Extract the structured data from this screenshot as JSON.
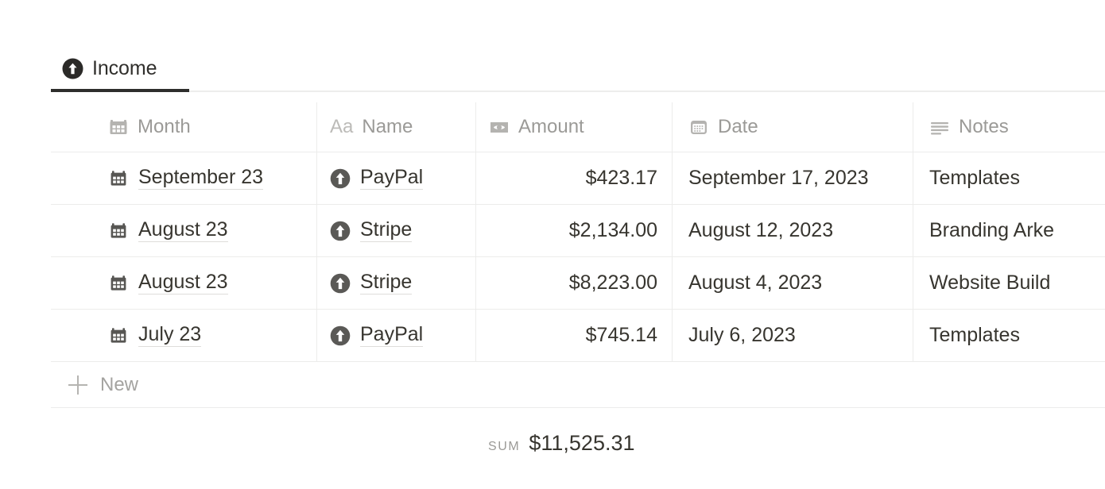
{
  "tab": {
    "label": "Income",
    "icon": "up-arrow-circle-icon",
    "active": true,
    "underline_color": "#2e2e2c"
  },
  "table": {
    "columns": [
      {
        "key": "month",
        "label": "Month",
        "icon": "calendar-icon",
        "align": "left"
      },
      {
        "key": "name",
        "label": "Name",
        "icon": "aa-text-icon",
        "align": "left"
      },
      {
        "key": "amount",
        "label": "Amount",
        "icon": "banknote-icon",
        "align": "right"
      },
      {
        "key": "date",
        "label": "Date",
        "icon": "date-icon",
        "align": "left"
      },
      {
        "key": "notes",
        "label": "Notes",
        "icon": "text-lines-icon",
        "align": "left"
      }
    ],
    "rows": [
      {
        "month": "September 23",
        "month_icon": "calendar-icon",
        "name": "PayPal",
        "name_icon": "up-arrow-circle-icon",
        "amount": "$423.17",
        "date": "September 17, 2023",
        "notes": "Templates"
      },
      {
        "month": "August 23",
        "month_icon": "calendar-icon",
        "name": "Stripe",
        "name_icon": "up-arrow-circle-icon",
        "amount": "$2,134.00",
        "date": "August 12, 2023",
        "notes": "Branding Arke"
      },
      {
        "month": "August 23",
        "month_icon": "calendar-icon",
        "name": "Stripe",
        "name_icon": "up-arrow-circle-icon",
        "amount": "$8,223.00",
        "date": "August 4, 2023",
        "notes": "Website Build"
      },
      {
        "month": "July 23",
        "month_icon": "calendar-icon",
        "name": "PayPal",
        "name_icon": "up-arrow-circle-icon",
        "amount": "$745.14",
        "date": "July 6, 2023",
        "notes": "Templates"
      }
    ],
    "new_row": {
      "label": "New",
      "icon": "plus-icon"
    },
    "footer": {
      "label": "SUM",
      "value": "$11,525.31"
    }
  },
  "colors": {
    "text": "#37352f",
    "muted": "#9b9a97",
    "border": "#ececeb",
    "icon_dark": "#575653",
    "icon_light": "#b4b3b0"
  }
}
